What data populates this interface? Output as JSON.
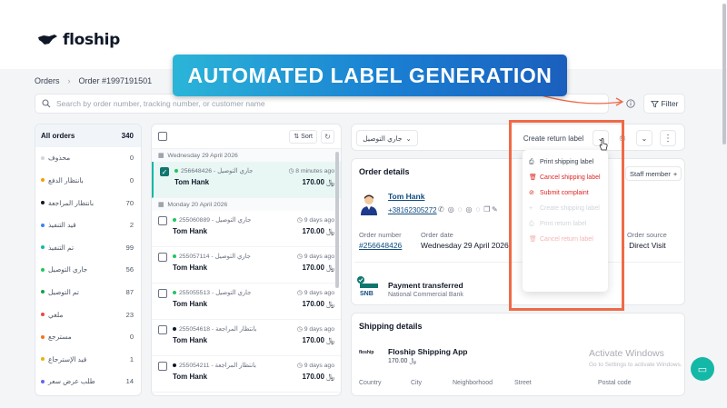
{
  "brand": {
    "name": "floship"
  },
  "banner": {
    "text": "AUTOMATED LABEL GENERATION"
  },
  "breadcrumb": {
    "root": "Orders",
    "current": "Order #1997191501"
  },
  "search": {
    "placeholder": "Search by order number, tracking number, or customer name"
  },
  "toolbar": {
    "filter_label": "Filter"
  },
  "statuses": [
    {
      "label": "All orders",
      "count": "340",
      "color": ""
    },
    {
      "label": "محذوف",
      "count": "0",
      "color": "#d1d5db"
    },
    {
      "label": "بانتظار الدفع",
      "count": "0",
      "color": "#f59e0b"
    },
    {
      "label": "بانتظار المراجعة",
      "count": "70",
      "color": "#111827"
    },
    {
      "label": "قيد التنفيذ",
      "count": "2",
      "color": "#3b82f6"
    },
    {
      "label": "تم التنفيذ",
      "count": "99",
      "color": "#14b8a6"
    },
    {
      "label": "جاري التوصيل",
      "count": "56",
      "color": "#22c55e"
    },
    {
      "label": "تم التوصيل",
      "count": "87",
      "color": "#16a34a"
    },
    {
      "label": "ملغي",
      "count": "23",
      "color": "#ef4444"
    },
    {
      "label": "مسترجع",
      "count": "0",
      "color": "#f97316"
    },
    {
      "label": "قيد الإسترجاع",
      "count": "1",
      "color": "#eab308"
    },
    {
      "label": "طلب عرض سعر",
      "count": "14",
      "color": "#6366f1"
    }
  ],
  "orders_list": {
    "sort_label": "Sort",
    "groups": [
      {
        "date": "Wednesday 29 April 2026",
        "orders": [
          {
            "number": "256648426 - جاري التوصيل",
            "time": "8 minutes ago",
            "customer": "Tom Hank",
            "amount": "170.00",
            "selected": true,
            "dot": "#22c55e"
          }
        ]
      },
      {
        "date": "Monday 20 April 2026",
        "orders": [
          {
            "number": "255060889 - جاري التوصيل",
            "time": "9 days ago",
            "customer": "Tom Hank",
            "amount": "170.00",
            "selected": false,
            "dot": "#22c55e"
          },
          {
            "number": "255057114 - جاري التوصيل",
            "time": "9 days ago",
            "customer": "Tom Hank",
            "amount": "170.00",
            "selected": false,
            "dot": "#22c55e"
          },
          {
            "number": "255055513 - جاري التوصيل",
            "time": "9 days ago",
            "customer": "Tom Hank",
            "amount": "170.00",
            "selected": false,
            "dot": "#22c55e"
          },
          {
            "number": "255054618 - بانتظار المراجعة",
            "time": "9 days ago",
            "customer": "Tom Hank",
            "amount": "170.00",
            "selected": false,
            "dot": "#111827"
          },
          {
            "number": "255054211 - بانتظار المراجعة",
            "time": "9 days ago",
            "customer": "Tom Hank",
            "amount": "170.00",
            "selected": false,
            "dot": "#111827"
          }
        ]
      }
    ]
  },
  "detail": {
    "status_select": "جاري التوصيل",
    "create_return_label": "Create return label",
    "order_details_title": "Order details",
    "staff_member_label": "Staff member",
    "customer": {
      "name": "Tom Hank",
      "phone": "+38162305272"
    },
    "fields": {
      "order_number_label": "Order number",
      "order_number": "#256648426",
      "order_date_label": "Order date",
      "order_date": "Wednesday 29 April 2026",
      "order_source_label": "Order source",
      "order_source": "Direct Visit"
    },
    "payment": {
      "title": "Payment transferred",
      "bank": "National Commercial Bank",
      "bank_logo": "SNB"
    },
    "shipping": {
      "title": "Shipping details",
      "logo": "floship",
      "app": "Floship Shipping App",
      "price": "170.00",
      "columns": [
        "Country",
        "City",
        "Neighborhood",
        "Street",
        "Postal code"
      ]
    }
  },
  "dropdown": {
    "items": [
      {
        "label": "Print shipping label",
        "state": "normal",
        "icon": "printer-icon"
      },
      {
        "label": "Cancel shipping label",
        "state": "danger",
        "icon": "trash-icon"
      },
      {
        "label": "Submit complaint",
        "state": "danger",
        "icon": "link-icon"
      },
      {
        "label": "Create shipping label",
        "state": "disabled",
        "icon": "plus-icon"
      },
      {
        "label": "Print return label",
        "state": "disabled",
        "icon": "printer-icon"
      },
      {
        "label": "Cancel return label",
        "state": "disabled-red",
        "icon": "trash-icon"
      }
    ]
  },
  "watermark": {
    "title": "Activate Windows",
    "subtitle": "Go to Settings to activate Windows."
  },
  "colors": {
    "accent": "#14b8a6",
    "highlight": "#ef6a47",
    "banner_start": "#2bb5d8",
    "banner_end": "#1b5fbd",
    "link": "#0f4c81"
  }
}
